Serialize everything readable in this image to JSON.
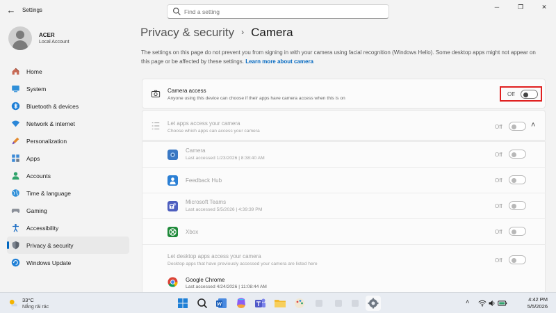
{
  "window": {
    "app_title": "Settings",
    "back_glyph": "←",
    "controls": [
      "─",
      "❐",
      "✕"
    ]
  },
  "search": {
    "placeholder": "Find a setting"
  },
  "profile": {
    "name": "ACER",
    "account_type": "Local Account"
  },
  "sidebar": {
    "items": [
      {
        "label": "Home",
        "icon": "home-icon"
      },
      {
        "label": "System",
        "icon": "monitor-icon"
      },
      {
        "label": "Bluetooth & devices",
        "icon": "bluetooth-icon"
      },
      {
        "label": "Network & internet",
        "icon": "wifi-icon"
      },
      {
        "label": "Personalization",
        "icon": "brush-icon"
      },
      {
        "label": "Apps",
        "icon": "apps-icon"
      },
      {
        "label": "Accounts",
        "icon": "person-icon"
      },
      {
        "label": "Time & language",
        "icon": "globe-icon"
      },
      {
        "label": "Gaming",
        "icon": "controller-icon"
      },
      {
        "label": "Accessibility",
        "icon": "accessibility-icon"
      },
      {
        "label": "Privacy & security",
        "icon": "shield-icon",
        "selected": true
      },
      {
        "label": "Windows Update",
        "icon": "update-icon"
      }
    ]
  },
  "breadcrumb": {
    "parent": "Privacy & security",
    "separator": "›",
    "current": "Camera"
  },
  "description": {
    "text": "The settings on this page do not prevent you from signing in with your camera using facial recognition (Windows Hello). Some desktop apps might not appear on this page or be affected by these settings.",
    "link": "Learn more about camera"
  },
  "camera_access": {
    "title": "Camera access",
    "subtitle": "Anyone using this device can choose if their apps have camera access when this is on",
    "state": "Off",
    "on": false
  },
  "let_apps": {
    "title": "Let apps access your camera",
    "subtitle": "Choose which apps can access your camera",
    "state": "Off",
    "chevron": "˄"
  },
  "apps": [
    {
      "name": "Camera",
      "detail": "Last accessed 1/23/2026  |  8:38:40 AM",
      "state": "Off",
      "icon": "camera-app-icon"
    },
    {
      "name": "Feedback Hub",
      "detail": "",
      "state": "Off",
      "icon": "feedback-hub-icon"
    },
    {
      "name": "Microsoft Teams",
      "detail": "Last accessed 5/5/2026  |  4:39:39 PM",
      "state": "Off",
      "icon": "teams-icon"
    },
    {
      "name": "Xbox",
      "detail": "",
      "state": "Off",
      "icon": "xbox-icon"
    }
  ],
  "desktop_apps": {
    "title": "Let desktop apps access your camera",
    "subtitle": "Desktop apps that have previously accessed your camera are listed here",
    "state": "Off",
    "items": [
      {
        "name": "Google Chrome",
        "detail": "Last accessed 4/24/2026  |  11:08:44 AM",
        "icon": "chrome-icon"
      }
    ]
  },
  "taskbar": {
    "weather": {
      "temp": "33°C",
      "condition": "Nắng rải rác"
    },
    "clock": {
      "time": "4:42 PM",
      "date": "5/5/2026"
    },
    "tray_chevron": "˄",
    "colors": {
      "accent": "#0067c0"
    }
  }
}
